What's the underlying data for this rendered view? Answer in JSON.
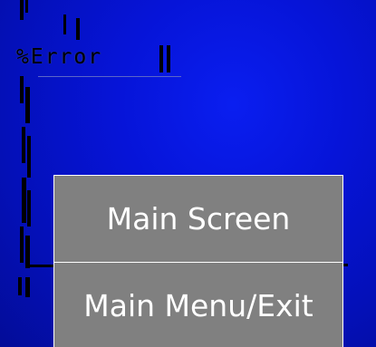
{
  "screen": {
    "error_text": "%Error",
    "background_color": "#0614d8"
  },
  "menu": {
    "items": [
      {
        "label": "Main Screen"
      },
      {
        "label": "Main Menu/Exit"
      }
    ],
    "button_color": "#808080",
    "text_color": "#ffffff"
  }
}
